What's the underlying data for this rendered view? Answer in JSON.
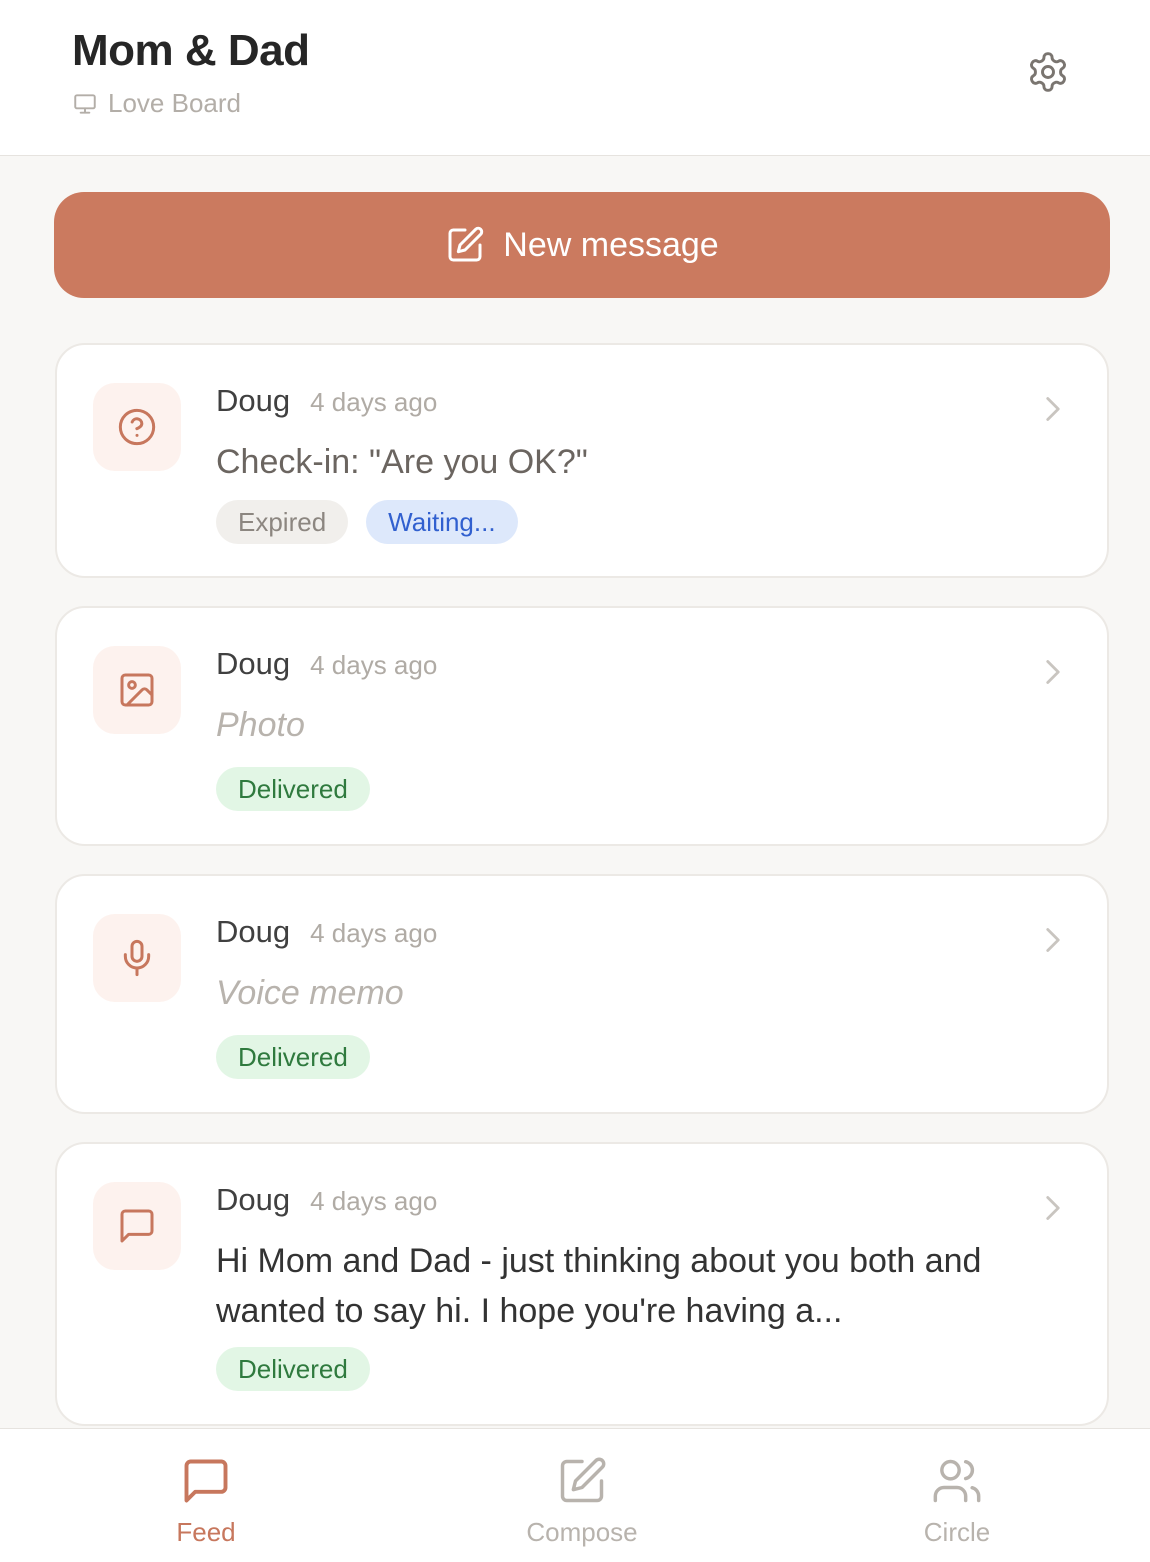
{
  "header": {
    "title": "Mom & Dad",
    "subtitle": "Love Board",
    "subtitle_icon": "monitor-icon",
    "settings_icon": "gear-icon"
  },
  "new_message": {
    "label": "New message",
    "icon": "edit-icon"
  },
  "feed": {
    "items": [
      {
        "icon": "question-circle-icon",
        "author": "Doug",
        "time": "4 days ago",
        "text": "Check-in: \"Are you OK?\"",
        "badges": [
          "Expired",
          "Waiting..."
        ]
      },
      {
        "icon": "image-icon",
        "author": "Doug",
        "time": "4 days ago",
        "text": "Photo",
        "badges": [
          "Delivered"
        ]
      },
      {
        "icon": "microphone-icon",
        "author": "Doug",
        "time": "4 days ago",
        "text": "Voice memo",
        "badges": [
          "Delivered"
        ]
      },
      {
        "icon": "chat-bubble-icon",
        "author": "Doug",
        "time": "4 days ago",
        "text": "Hi Mom and Dad - just thinking about you both and wanted to say hi. I hope you're having a...",
        "badges": [
          "Delivered"
        ]
      }
    ]
  },
  "tabs": [
    {
      "label": "Feed",
      "icon": "chat-bubble-icon",
      "active": true
    },
    {
      "label": "Compose",
      "icon": "edit-icon",
      "active": false
    },
    {
      "label": "Circle",
      "icon": "users-icon",
      "active": false
    }
  ],
  "colors": {
    "accent": "#cb7a5f",
    "waiting": "#3160cf",
    "delivered": "#2f7a3e",
    "background": "#f8f7f5"
  }
}
